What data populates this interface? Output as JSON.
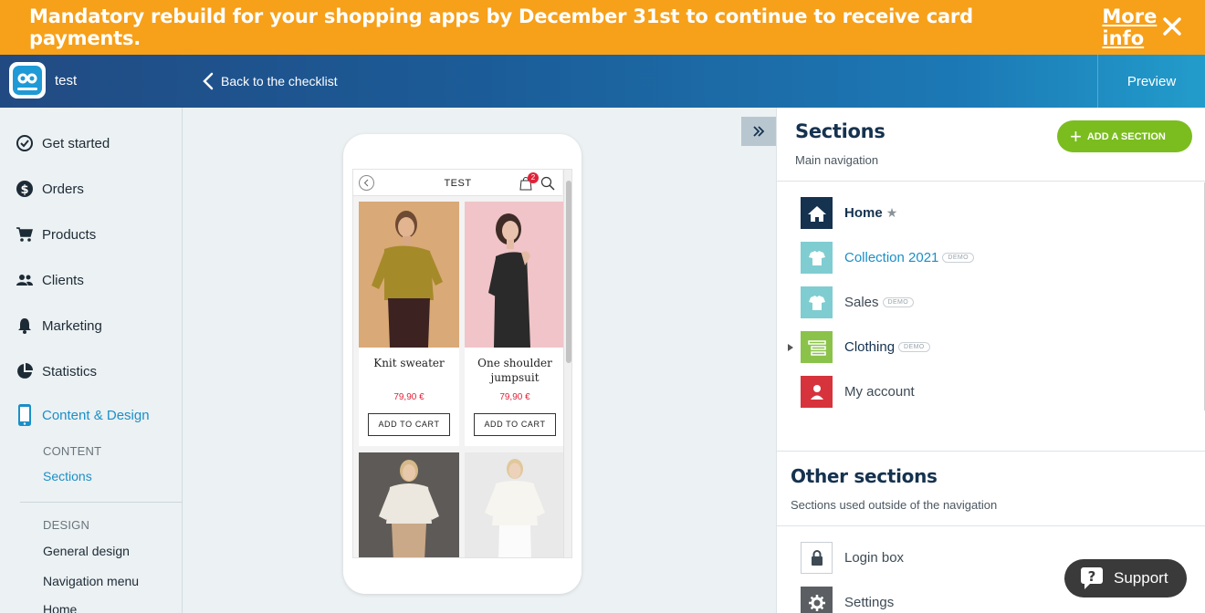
{
  "banner": {
    "text": "Mandatory rebuild for your shopping apps by December 31st to continue to receive card payments.",
    "link": "More info"
  },
  "topbar": {
    "app_name": "test",
    "back_label": "Back to the checklist",
    "preview_label": "Preview"
  },
  "sidebar": {
    "items": [
      {
        "label": "Get started",
        "icon": "check-circle-icon"
      },
      {
        "label": "Orders",
        "icon": "dollar-icon"
      },
      {
        "label": "Products",
        "icon": "cart-icon"
      },
      {
        "label": "Clients",
        "icon": "people-icon"
      },
      {
        "label": "Marketing",
        "icon": "bell-icon"
      },
      {
        "label": "Statistics",
        "icon": "pie-chart-icon"
      },
      {
        "label": "Content & Design",
        "icon": "phone-icon"
      }
    ],
    "content_heading": "CONTENT",
    "content_items": [
      "Sections"
    ],
    "design_heading": "DESIGN",
    "design_items": [
      "General design",
      "Navigation menu",
      "Home"
    ]
  },
  "preview": {
    "app_title": "TEST",
    "cart_count": "2",
    "products": [
      {
        "name": "Knit sweater",
        "price": "79,90 €",
        "button": "ADD TO CART"
      },
      {
        "name": "One shoulder jumpsuit",
        "price": "79,90 €",
        "button": "ADD TO CART"
      }
    ]
  },
  "sections_panel": {
    "title": "Sections",
    "subtitle": "Main navigation",
    "add_button": "ADD A SECTION",
    "demo_tag": "DEMO",
    "main_sections": [
      {
        "label": "Home",
        "icon": "home-icon",
        "color": "#15324f"
      },
      {
        "label": "Collection 2021",
        "icon": "shirts-icon",
        "color": "#7fcdd1"
      },
      {
        "label": "Sales",
        "icon": "shirts-icon",
        "color": "#7fcdd1"
      },
      {
        "label": "Clothing",
        "icon": "list-icon",
        "color": "#8bc34a"
      },
      {
        "label": "My account",
        "icon": "user-icon",
        "color": "#d7333d"
      }
    ],
    "other_title": "Other sections",
    "other_subtitle": "Sections used outside of the navigation",
    "other_sections": [
      {
        "label": "Login box",
        "icon": "lock-icon"
      },
      {
        "label": "Settings",
        "icon": "gear-icon"
      }
    ]
  },
  "support": {
    "label": "Support"
  }
}
